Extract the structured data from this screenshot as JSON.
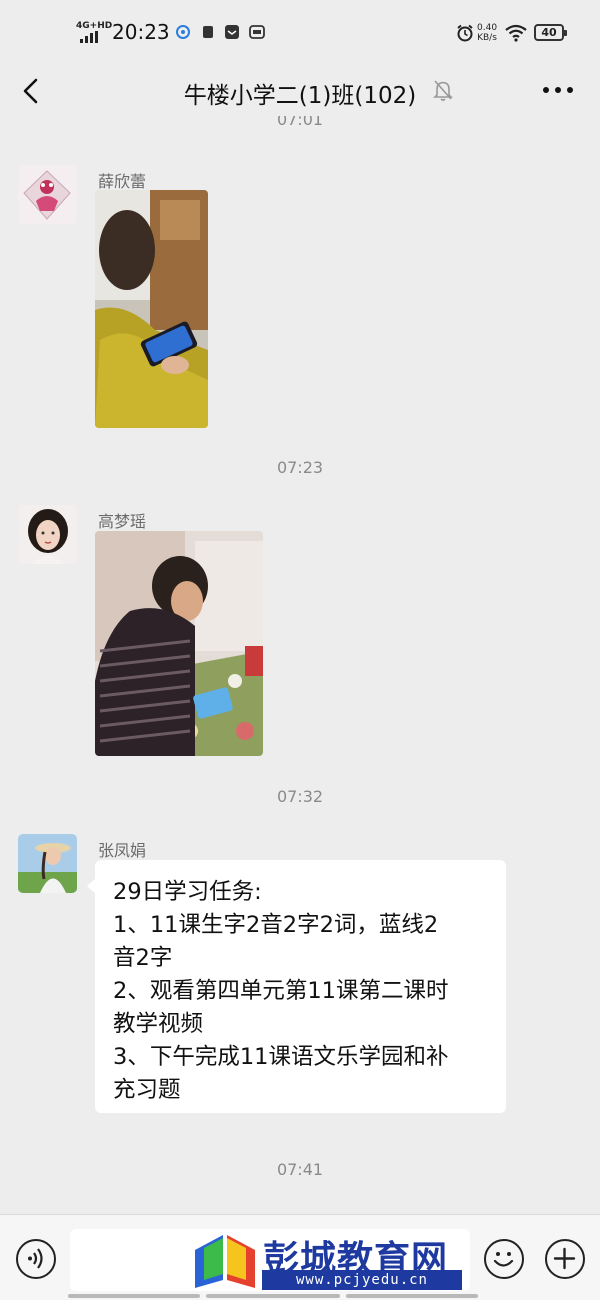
{
  "status_bar": {
    "network": "4G+HD",
    "time": "20:23",
    "speed_value": "0.40",
    "speed_unit": "KB/s",
    "battery": "40"
  },
  "header": {
    "title": "牛楼小学二(1)班(102)",
    "back_icon": "chevron-left-icon",
    "mute_icon": "bell-off-icon",
    "more_icon": "more-dots-icon"
  },
  "messages": {
    "top_partial_time": "07:01",
    "msg1": {
      "sender": "薛欣蕾",
      "type": "image"
    },
    "time2": "07:23",
    "msg2": {
      "sender": "高梦瑶",
      "type": "image"
    },
    "time3": "07:32",
    "msg3": {
      "sender": "张凤娟",
      "lines": [
        "29日学习任务:",
        "1、11课生字2音2字2词，蓝线2",
        "音2字",
        "2、观看第四单元第11课第二课时",
        "教学视频",
        "3、下午完成11课语文乐学园和补",
        "充习题"
      ]
    },
    "time4": "07:41"
  },
  "input_bar": {
    "voice_icon": "voice-icon",
    "emoji_icon": "emoji-icon",
    "plus_icon": "plus-icon"
  },
  "watermark": {
    "name": "彭城教育网",
    "url": "www.pcjyedu.cn"
  },
  "colors": {
    "background": "#ededed",
    "bubble": "#ffffff",
    "watermark_blue": "#1e3aa0"
  }
}
